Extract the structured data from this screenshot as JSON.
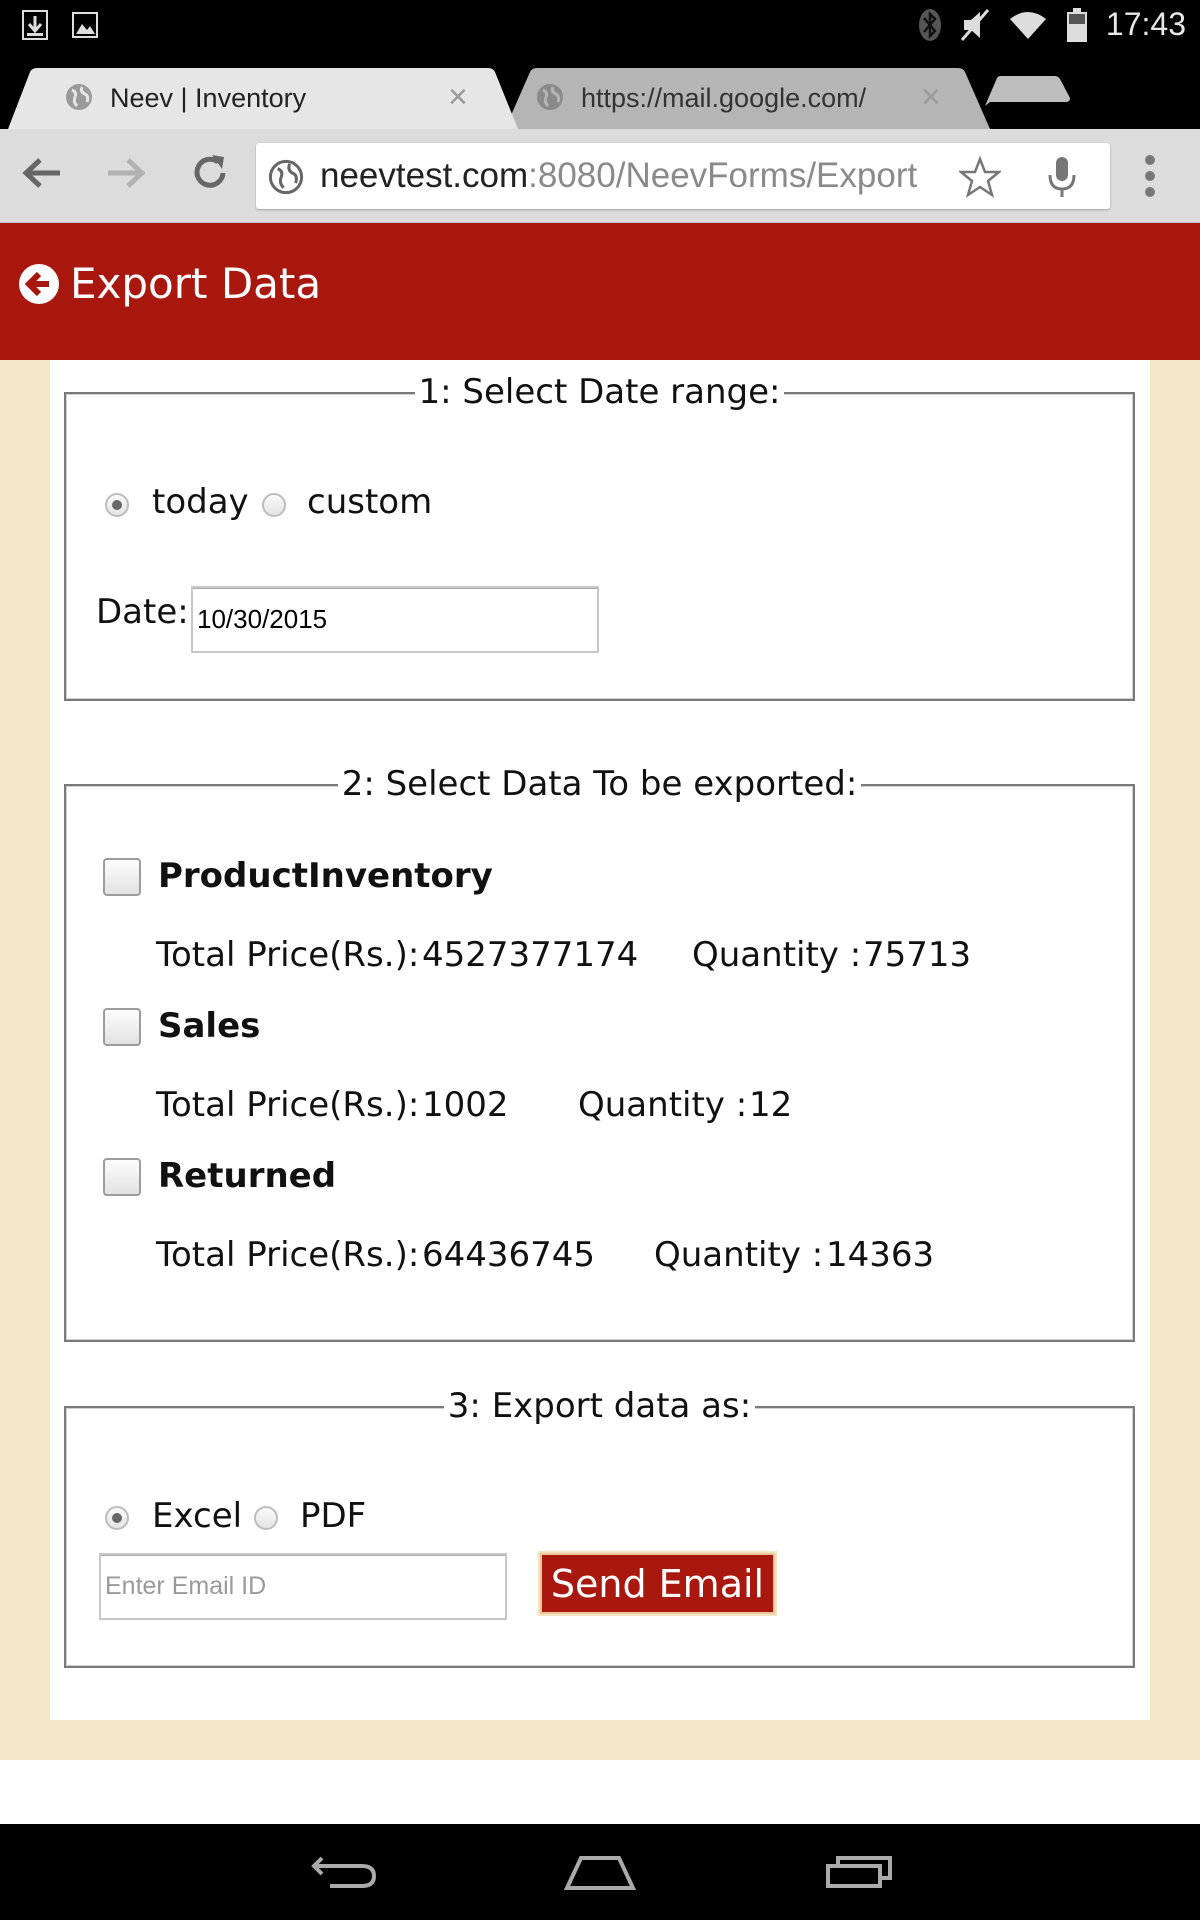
{
  "status_bar": {
    "time": "17:43",
    "icons": [
      "download-icon",
      "image-icon",
      "bluetooth-icon",
      "mute-icon",
      "wifi-icon",
      "battery-icon"
    ]
  },
  "browser": {
    "tabs": [
      {
        "title": "Neev | Inventory",
        "active": true
      },
      {
        "title": "https://mail.google.com/",
        "active": false
      }
    ],
    "url_host": "neevtest.com",
    "url_rest": ":8080/NeevForms/Export"
  },
  "header": {
    "title": "Export Data"
  },
  "date_section": {
    "legend": "1: Select Date range:",
    "option_today": "today",
    "option_custom": "custom",
    "selected": "today",
    "date_label": "Date:",
    "date_value": "10/30/2015"
  },
  "data_section": {
    "legend": "2: Select Data To be exported:",
    "price_label": "Total Price(Rs.):",
    "quantity_label": "Quantity :",
    "items": [
      {
        "name": "ProductInventory",
        "total_price": "4527377174",
        "quantity": "75713",
        "checked": false
      },
      {
        "name": "Sales",
        "total_price": "1002",
        "quantity": "12",
        "checked": false
      },
      {
        "name": "Returned",
        "total_price": "64436745",
        "quantity": "14363",
        "checked": false
      }
    ]
  },
  "export_section": {
    "legend": "3: Export data as:",
    "option_excel": "Excel",
    "option_pdf": "PDF",
    "selected": "Excel",
    "email_placeholder": "Enter Email ID",
    "send_label": "Send Email"
  },
  "colors": {
    "brand_red": "#a9180f",
    "page_bg": "#f3e9c8"
  }
}
